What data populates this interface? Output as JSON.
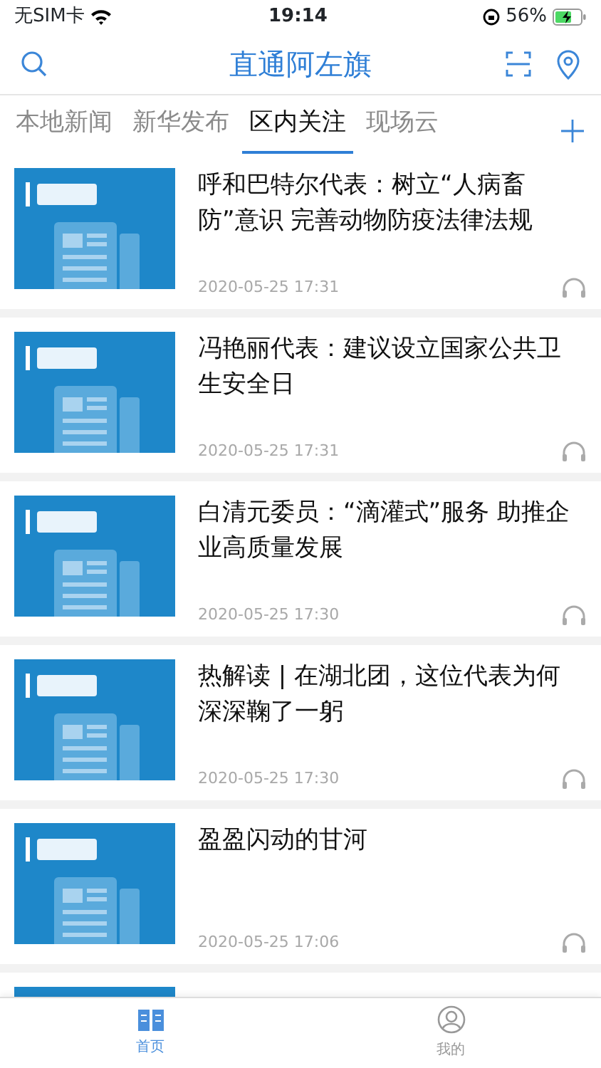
{
  "status_bar": {
    "carrier": "无SIM卡",
    "time": "19:14",
    "battery": "56%"
  },
  "header": {
    "title": "直通阿左旗"
  },
  "tabs": [
    {
      "label": "本地新闻",
      "selected": false
    },
    {
      "label": "新华发布",
      "selected": false
    },
    {
      "label": "区内关注",
      "selected": true
    },
    {
      "label": "现场云",
      "selected": false
    }
  ],
  "articles": [
    {
      "kind": "article",
      "title": "呼和巴特尔代表：树立“人病畜防”意识 完善动物防疫法律法规",
      "date": "2020-05-25 17:31"
    },
    {
      "kind": "article",
      "title": "冯艳丽代表：建议设立国家公共卫生安全日",
      "date": "2020-05-25 17:31"
    },
    {
      "kind": "article",
      "title": "白清元委员：“滴灌式”服务 助推企业高质量发展",
      "date": "2020-05-25 17:30"
    },
    {
      "kind": "article",
      "title": "热解读 | 在湖北团，这位代表为何深深鞠了一躬",
      "date": "2020-05-25 17:30"
    },
    {
      "kind": "article",
      "title": "盈盈闪动的甘河",
      "date": "2020-05-25 17:06"
    },
    {
      "kind": "picture"
    }
  ],
  "tab_bar": [
    {
      "label": "首页",
      "selected": true
    },
    {
      "label": "我的",
      "selected": false
    }
  ]
}
